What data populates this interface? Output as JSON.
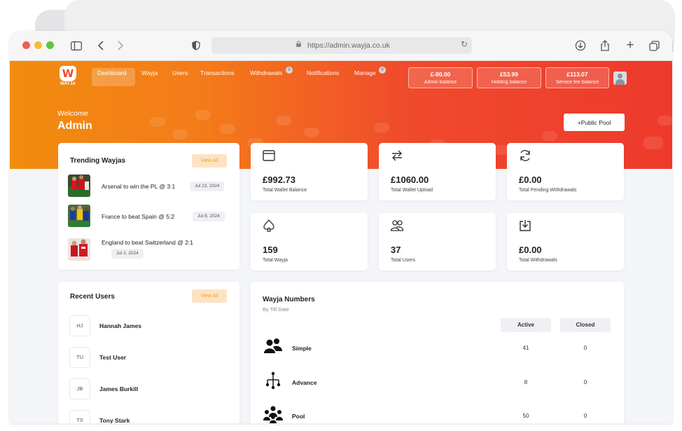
{
  "browser": {
    "url": "https://admin.wayja.co.uk"
  },
  "logo": {
    "letter": "W",
    "text": "WAYJA"
  },
  "nav": {
    "items": [
      {
        "label": "Dashboard"
      },
      {
        "label": "Wayja"
      },
      {
        "label": "Users"
      },
      {
        "label": "Transactions"
      },
      {
        "label": "Withdrawals",
        "badge": "0"
      },
      {
        "label": "Notifications"
      },
      {
        "label": "Manage",
        "badge": "0"
      }
    ]
  },
  "balances": [
    {
      "amount": "£-80.00",
      "label": "Admin balance"
    },
    {
      "amount": "£53.99",
      "label": "Holding balance"
    },
    {
      "amount": "£113.07",
      "label": "Service fee balance"
    }
  ],
  "welcome": {
    "greeting": "Welcome",
    "name": "Admin"
  },
  "public_pool_button": "+Public Pool",
  "trending": {
    "title": "Trending Wayjas",
    "view_all": "View All",
    "items": [
      {
        "title": "Arsenal to win the PL @ 3:1",
        "date": "Jul 23, 2024"
      },
      {
        "title": "France to beat Spain @ 5:2",
        "date": "Jul 8, 2024"
      },
      {
        "title": "England to beat Switzerland @ 2:1",
        "date": "Jul 2, 2024"
      }
    ]
  },
  "stats": [
    {
      "icon": "wallet-icon",
      "value": "£992.73",
      "label": "Total Wallet Balance"
    },
    {
      "icon": "transfer-arrows-icon",
      "value": "£1060.00",
      "label": "Total Wallet Upload"
    },
    {
      "icon": "refresh-icon",
      "value": "£0.00",
      "label": "Total Pending Withdrawals"
    },
    {
      "icon": "spade-icon",
      "value": "159",
      "label": "Total Wayja"
    },
    {
      "icon": "users-icon",
      "value": "37",
      "label": "Total Users"
    },
    {
      "icon": "download-tray-icon",
      "value": "£0.00",
      "label": "Total Withdrawals"
    }
  ],
  "recent_users": {
    "title": "Recent Users",
    "view_all": "View All",
    "items": [
      {
        "initials": "HJ",
        "name": "Hannah James"
      },
      {
        "initials": "TU",
        "name": "Test User"
      },
      {
        "initials": "JB",
        "name": "James Burkill"
      },
      {
        "initials": "TS",
        "name": "Tony Stark"
      }
    ]
  },
  "wayja_numbers": {
    "title": "Wayja Numbers",
    "subtitle": "By Till Date",
    "columns": [
      "Active",
      "Closed"
    ],
    "rows": [
      {
        "icon": "people-pair-icon",
        "label": "Simple",
        "active": "41",
        "closed": "0"
      },
      {
        "icon": "network-tree-icon",
        "label": "Advance",
        "active": "8",
        "closed": "0"
      },
      {
        "icon": "people-group-icon",
        "label": "Pool",
        "active": "50",
        "closed": "0"
      }
    ]
  },
  "colors": {
    "hero_start": "#f28c0e",
    "hero_end": "#ee3a2c",
    "view_all_bg": "#fde3c2",
    "view_all_text": "#f39c2a"
  }
}
